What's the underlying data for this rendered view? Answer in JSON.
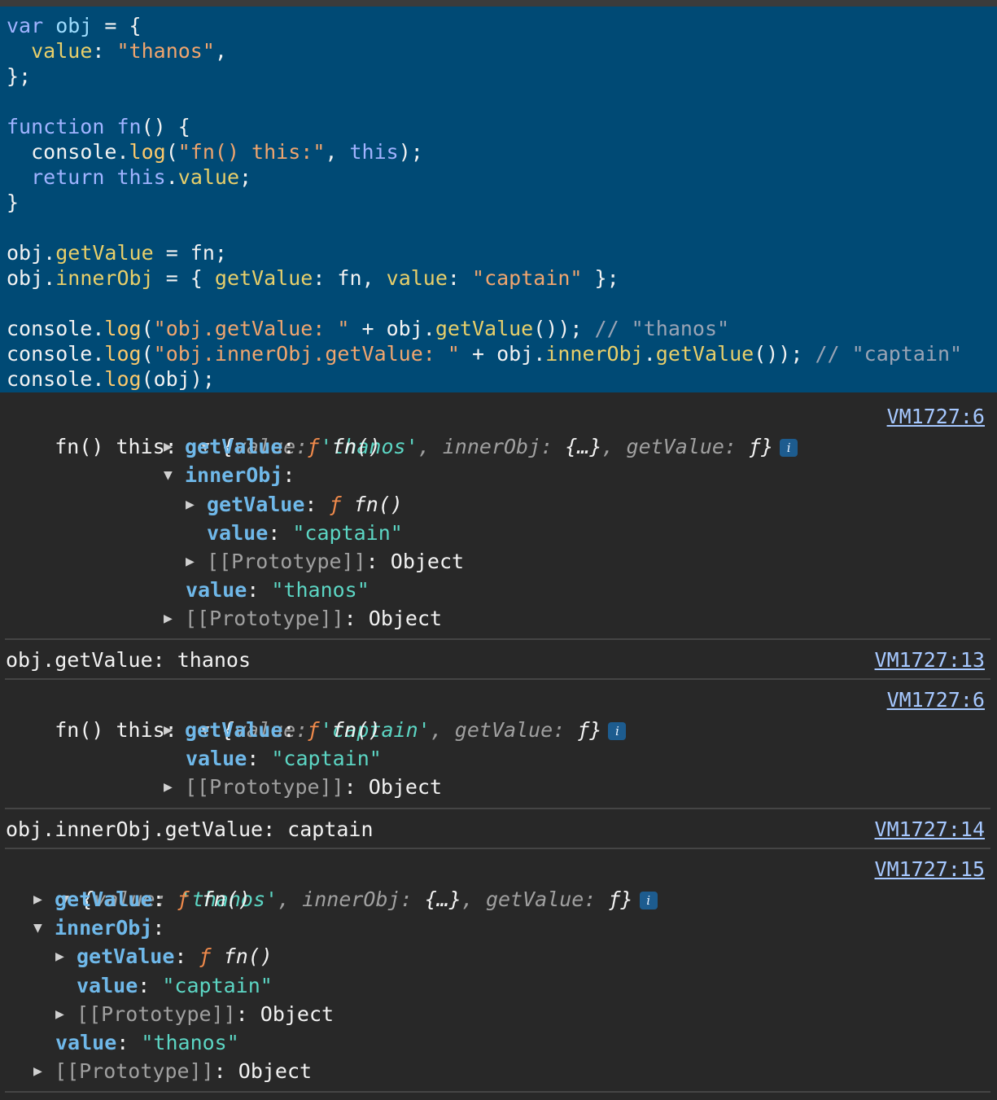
{
  "code": {
    "l1_kw": "var",
    "l1_id": "obj",
    "l1_rest": " = {",
    "l2_prop": "value",
    "l2_str": "\"thanos\"",
    "l2_end": ",",
    "l3": "};",
    "l5_kw": "function",
    "l5_fn": "fn",
    "l5_rest": "() {",
    "l6_a": "console.",
    "l6_fn": "log",
    "l6_p": "(",
    "l6_str": "\"fn() this:\"",
    "l6_c": ", ",
    "l6_kw": "this",
    "l6_e": ");",
    "l7_kw": "return",
    "l7_this": "this",
    "l7_dot": ".",
    "l7_prop": "value",
    "l7_e": ";",
    "l8": "}",
    "l10_a": "obj.",
    "l10_prop": "getValue",
    "l10_e": " = fn;",
    "l11_a": "obj.",
    "l11_prop": "innerObj",
    "l11_b": " = { ",
    "l11_p1": "getValue",
    "l11_c": ": fn, ",
    "l11_p2": "value",
    "l11_d": ": ",
    "l11_str": "\"captain\"",
    "l11_e": " };",
    "l13_a": "console.",
    "l13_fn": "log",
    "l13_p": "(",
    "l13_str": "\"obj.getValue: \"",
    "l13_b": " + obj.",
    "l13_prop": "getValue",
    "l13_c": "()); ",
    "l13_cm": "// \"thanos\"",
    "l14_a": "console.",
    "l14_fn": "log",
    "l14_p": "(",
    "l14_str": "\"obj.innerObj.getValue: \"",
    "l14_b": " + obj.",
    "l14_prop1": "innerObj",
    "l14_dot": ".",
    "l14_prop2": "getValue",
    "l14_c": "()); ",
    "l14_cm": "// \"captain\"",
    "l15_a": "console.",
    "l15_fn": "log",
    "l15_e": "(obj);"
  },
  "console": {
    "entry1": {
      "label": "fn() this: ",
      "summary_open": "{",
      "summary_k1": "value: ",
      "summary_v1": "'thanos'",
      "summary_k2": ", innerObj: ",
      "summary_v2": "{…}",
      "summary_k3": ", getValue: ",
      "summary_v3": "ƒ",
      "summary_close": "}",
      "badge": "i",
      "link": "VM1727:6",
      "rows": {
        "getvalue_key": "getValue",
        "getvalue_f": "ƒ",
        "getvalue_name": "fn()",
        "inner_key": "innerObj",
        "inner_getvalue_key": "getValue",
        "inner_getvalue_f": "ƒ",
        "inner_getvalue_name": "fn()",
        "inner_value_key": "value",
        "inner_value_val": "\"captain\"",
        "inner_proto": "[[Prototype]]",
        "inner_proto_val": "Object",
        "value_key": "value",
        "value_val": "\"thanos\"",
        "proto": "[[Prototype]]",
        "proto_val": "Object"
      }
    },
    "entry2": {
      "text": "obj.getValue: thanos",
      "link": "VM1727:13"
    },
    "entry3": {
      "label": "fn() this: ",
      "summary_open": "{",
      "summary_k1": "value: ",
      "summary_v1": "'captain'",
      "summary_k2": ", getValue: ",
      "summary_v2": "ƒ",
      "summary_close": "}",
      "badge": "i",
      "link": "VM1727:6",
      "rows": {
        "getvalue_key": "getValue",
        "getvalue_f": "ƒ",
        "getvalue_name": "fn()",
        "value_key": "value",
        "value_val": "\"captain\"",
        "proto": "[[Prototype]]",
        "proto_val": "Object"
      }
    },
    "entry4": {
      "text": "obj.innerObj.getValue: captain",
      "link": "VM1727:14"
    },
    "entry5": {
      "summary_open": "{",
      "summary_k1": "value: ",
      "summary_v1": "'thanos'",
      "summary_k2": ", innerObj: ",
      "summary_v2": "{…}",
      "summary_k3": ", getValue: ",
      "summary_v3": "ƒ",
      "summary_close": "}",
      "badge": "i",
      "link": "VM1727:15",
      "rows": {
        "getvalue_key": "getValue",
        "getvalue_f": "ƒ",
        "getvalue_name": "fn()",
        "inner_key": "innerObj",
        "inner_getvalue_key": "getValue",
        "inner_getvalue_f": "ƒ",
        "inner_getvalue_name": "fn()",
        "inner_value_key": "value",
        "inner_value_val": "\"captain\"",
        "inner_proto": "[[Prototype]]",
        "inner_proto_val": "Object",
        "value_key": "value",
        "value_val": "\"thanos\"",
        "proto": "[[Prototype]]",
        "proto_val": "Object"
      }
    },
    "icons": {
      "expanded": "▼",
      "collapsed": "▶"
    }
  }
}
